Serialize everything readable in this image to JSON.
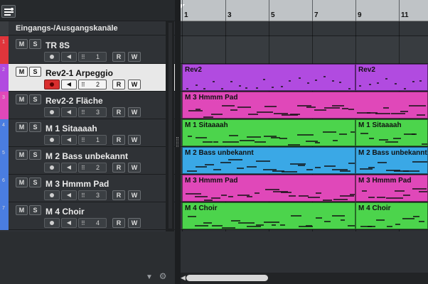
{
  "folder": {
    "label": "Eingangs-/Ausgangskanäle"
  },
  "buttons": {
    "mute": "M",
    "solo": "S",
    "read": "R",
    "write": "W"
  },
  "tracks": [
    {
      "num": "1",
      "name": "TR 8S",
      "channel": "1",
      "color": "#e0353b",
      "selected": false
    },
    {
      "num": "2",
      "name": "Rev2-1 Arpeggio",
      "channel": "2",
      "color": "#b14be0",
      "selected": true
    },
    {
      "num": "3",
      "name": "Rev2-2 Fläche",
      "channel": "3",
      "color": "#e048b9",
      "selected": false
    },
    {
      "num": "4",
      "name": "M 1 Sitaaaah",
      "channel": "1",
      "color": "#4a7de0",
      "selected": false
    },
    {
      "num": "5",
      "name": "M 2 Bass unbekannt",
      "channel": "2",
      "color": "#4a7de0",
      "selected": false
    },
    {
      "num": "6",
      "name": "M 3 Hmmm Pad",
      "channel": "3",
      "color": "#4a7de0",
      "selected": false
    },
    {
      "num": "7",
      "name": "M 4 Choir",
      "channel": "4",
      "color": "#4a7de0",
      "selected": false
    }
  ],
  "ruler": {
    "labels": [
      "1",
      "3",
      "5",
      "7",
      "9",
      "11"
    ]
  },
  "parts": [
    {
      "lane": 1,
      "name": "Rev2",
      "color": "#b14be0",
      "bar_start": 1,
      "bar_end": 9
    },
    {
      "lane": 1,
      "name": "Rev2",
      "color": "#b14be0",
      "bar_start": 9,
      "bar_end": 13
    },
    {
      "lane": 2,
      "name": "M 3 Hmmm Pad",
      "color": "#e048b9",
      "bar_start": 1,
      "bar_end": 13
    },
    {
      "lane": 3,
      "name": "M 1 Sitaaaah",
      "color": "#4cd44c",
      "bar_start": 1,
      "bar_end": 9
    },
    {
      "lane": 3,
      "name": "M 1 Sitaaaah",
      "color": "#4cd44c",
      "bar_start": 9,
      "bar_end": 13
    },
    {
      "lane": 4,
      "name": "M 2 Bass unbekannt",
      "color": "#3aa8e6",
      "bar_start": 1,
      "bar_end": 9
    },
    {
      "lane": 4,
      "name": "M 2 Bass unbekannt",
      "color": "#3aa8e6",
      "bar_start": 9,
      "bar_end": 13
    },
    {
      "lane": 5,
      "name": "M 3 Hmmm Pad",
      "color": "#e048b9",
      "bar_start": 1,
      "bar_end": 9
    },
    {
      "lane": 5,
      "name": "M 3 Hmmm Pad",
      "color": "#e048b9",
      "bar_start": 9,
      "bar_end": 13
    },
    {
      "lane": 6,
      "name": "M 4 Choir",
      "color": "#4cd44c",
      "bar_start": 1,
      "bar_end": 9
    },
    {
      "lane": 6,
      "name": "M 4 Choir",
      "color": "#4cd44c",
      "bar_start": 9,
      "bar_end": 13
    }
  ],
  "icons": {
    "toolbar": "track-list-icon",
    "record": "record-icon",
    "monitor": "speaker-icon",
    "channel": "channel-grid-icon",
    "collapse": "chevron-down-icon",
    "settings": "gear-icon",
    "scroll_left": "arrow-left-icon"
  }
}
